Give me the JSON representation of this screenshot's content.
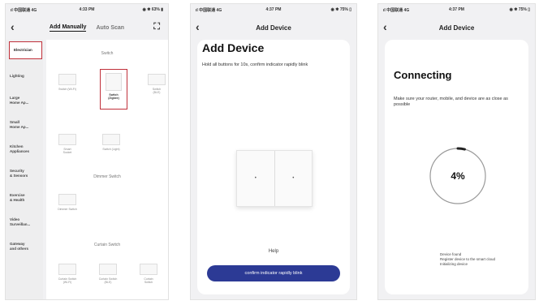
{
  "screen1": {
    "status": {
      "carrier": "ıl 中国联通 4G",
      "time": "4:33 PM",
      "battery": "◉ ✱ 63% ▮"
    },
    "tabs": [
      "Add Manually",
      "Auto Scan"
    ],
    "categories": [
      "Electrician",
      "Lighting",
      "Large\nHome Ap...",
      "Small\nHome Ap...",
      "Kitchen\nAppliances",
      "Security\n& Sensors",
      "Exercise\n& Health",
      "Video\nSurveillan...",
      "Gateway\nand others"
    ],
    "sections": {
      "switch": "Switch",
      "dimmer": "Dimmer Switch",
      "curtain": "Curtain Switch"
    },
    "devices": {
      "d1": "Switch (Wi-Fi)",
      "d2": "Switch\n(Zigbee)",
      "d3": "Switch\n(BLE)",
      "d4": "Smart\nSocket",
      "d5": "Switch (Light)",
      "d6": "Dimmer Switch",
      "d7": "Curtain Switch\n(Wi-Fi)",
      "d8": "Curtain Switch\n(BLE)",
      "d9": "Curtain\nSwitch"
    }
  },
  "screen2": {
    "status": {
      "carrier": "ıl 中国联通 4G",
      "time": "4:37 PM",
      "battery": "◉ ✱ 75% ▯"
    },
    "nav_title": "Add Device",
    "title": "Add Device",
    "description": "Hold all buttons for 10s, confirm indicator rapidly blink",
    "help": "Help",
    "button": "confirm indicator rapidly blink"
  },
  "screen3": {
    "status": {
      "carrier": "ıl 中国联通 4G",
      "time": "4:37 PM",
      "battery": "◉ ✱ 75% ▯"
    },
    "nav_title": "Add Device",
    "title": "Connecting",
    "description": "Make sure your router, mobile, and device are as close as possible",
    "progress_label": "4%",
    "progress_value": 0.04,
    "steps": [
      "Device found",
      "Register device to the smart cloud",
      "Initializing device"
    ]
  },
  "colors": {
    "accent": "#2c3a95",
    "selected_border": "#c0303a",
    "background": "#f1f1f3"
  }
}
